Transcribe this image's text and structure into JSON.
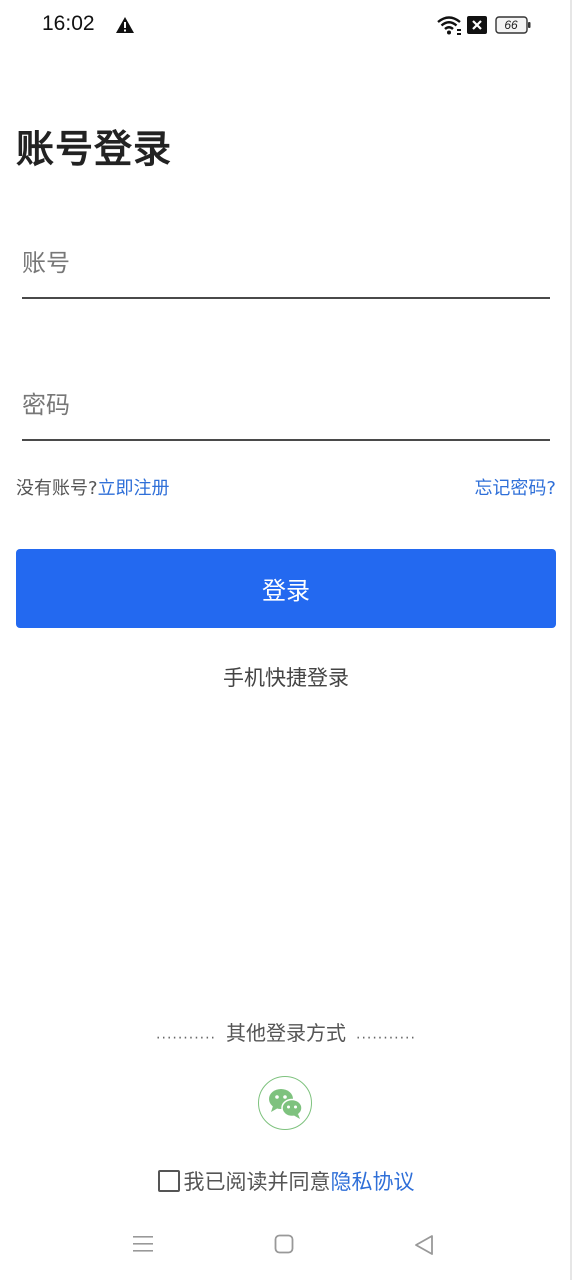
{
  "status_bar": {
    "time": "16:02",
    "battery": "66"
  },
  "page": {
    "title": "账号登录"
  },
  "form": {
    "account_placeholder": "账号",
    "password_placeholder": "密码"
  },
  "links": {
    "no_account": "没有账号?",
    "register": "立即注册",
    "forgot_password": "忘记密码?"
  },
  "buttons": {
    "login": "登录",
    "quick_login": "手机快捷登录"
  },
  "other_login": {
    "dots_left": "...........",
    "label": "其他登录方式",
    "dots_right": "..........."
  },
  "agreement": {
    "text": "我已阅读并同意",
    "privacy_link": "隐私协议"
  },
  "icons": {
    "warning": "warning-icon",
    "wifi": "wifi-icon",
    "close_box": "close-box-icon",
    "battery": "battery-icon",
    "wechat": "wechat-icon",
    "menu": "menu-icon",
    "home": "home-icon",
    "back": "back-icon"
  },
  "colors": {
    "primary": "#2369f0",
    "link": "#2f6fd8",
    "wechat_green": "#7ec27e"
  }
}
